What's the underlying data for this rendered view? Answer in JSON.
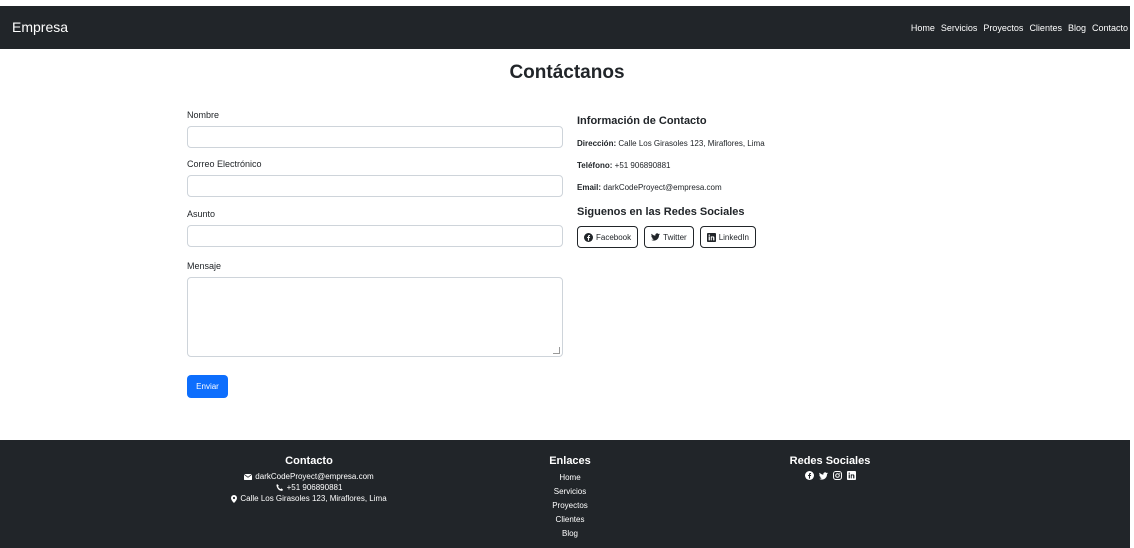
{
  "navbar": {
    "brand": "Empresa",
    "links": [
      "Home",
      "Servicios",
      "Proyectos",
      "Clientes",
      "Blog",
      "Contacto"
    ]
  },
  "page": {
    "title": "Contáctanos"
  },
  "form": {
    "name_label": "Nombre",
    "name_value": "",
    "email_label": "Correo Electrónico",
    "email_value": "",
    "subject_label": "Asunto",
    "subject_value": "",
    "message_label": "Mensaje",
    "message_value": "",
    "submit_label": "Enviar"
  },
  "contact_info": {
    "heading": "Información de Contacto",
    "address_label": "Dirección:",
    "address": "Calle Los Girasoles 123, Miraflores, Lima",
    "phone_label": "Teléfono:",
    "phone": "+51 906890881",
    "email_label": "Email:",
    "email": "darkCodeProyect@empresa.com"
  },
  "social": {
    "heading": "Siguenos en las Redes Sociales",
    "buttons": [
      {
        "label": "Facebook",
        "icon": "facebook-icon"
      },
      {
        "label": "Twitter",
        "icon": "twitter-icon"
      },
      {
        "label": "LinkedIn",
        "icon": "linkedin-icon"
      }
    ]
  },
  "footer": {
    "contact_title": "Contacto",
    "contact_email": "darkCodeProyect@empresa.com",
    "contact_phone": "+51 906890881",
    "contact_address": "Calle Los Girasoles 123, Miraflores, Lima",
    "links_title": "Enlaces",
    "links": [
      "Home",
      "Servicios",
      "Proyectos",
      "Clientes",
      "Blog"
    ],
    "social_title": "Redes Sociales",
    "social_icons": [
      "facebook-icon",
      "twitter-icon",
      "instagram-icon",
      "linkedin-icon"
    ]
  },
  "colors": {
    "dark": "#212529",
    "primary": "#0d6efd",
    "border": "#ced4da"
  }
}
